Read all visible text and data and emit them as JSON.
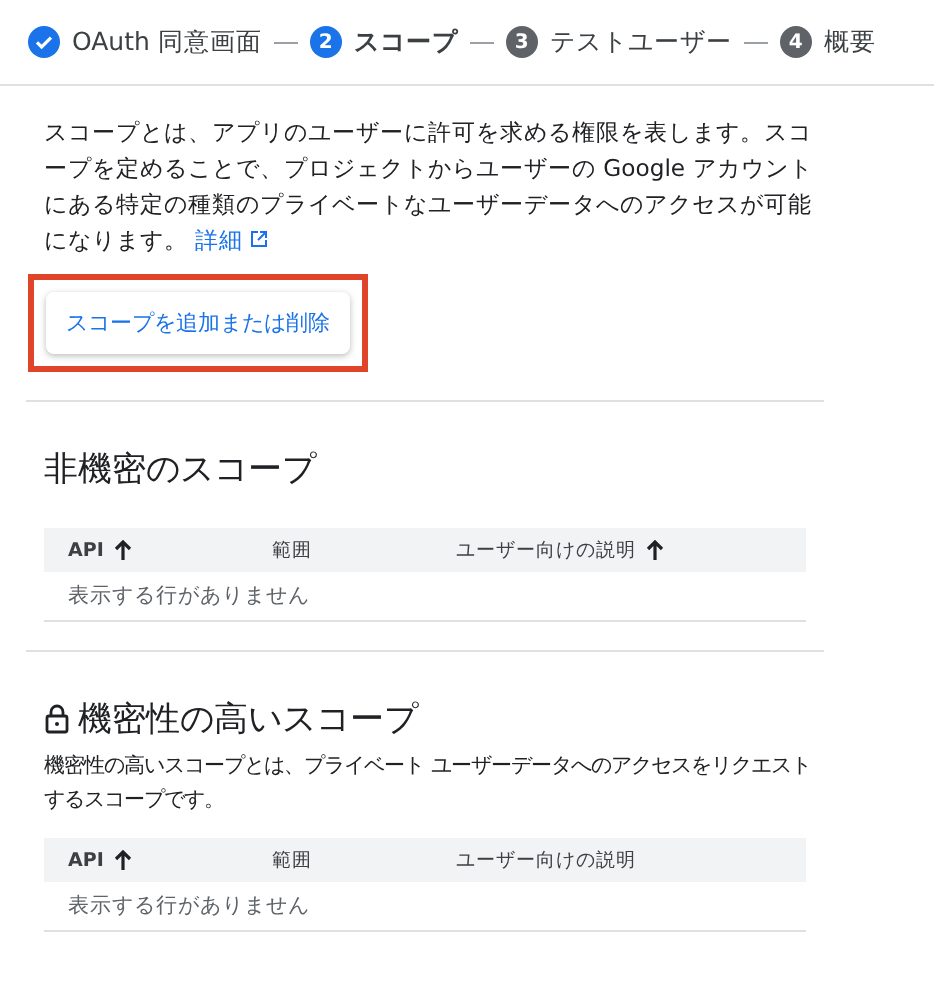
{
  "stepper": [
    {
      "kind": "done",
      "label": "OAuth 同意画面"
    },
    {
      "kind": "current",
      "number": "2",
      "label": "スコープ"
    },
    {
      "kind": "todo",
      "number": "3",
      "label": "テストユーザー"
    },
    {
      "kind": "todo",
      "number": "4",
      "label": "概要"
    }
  ],
  "intro": {
    "text": "スコープとは、アプリのユーザーに許可を求める権限を表します。スコープを定めることで、プロジェクトからユーザーの Google アカウントにある特定の種類のプライベートなユーザーデータへのアクセスが可能になります。",
    "link": "詳細"
  },
  "add_button": {
    "label": "スコープを追加または削除",
    "highlighted": true
  },
  "sections": [
    {
      "title": "非機密のスコープ",
      "locked": false,
      "columns": [
        {
          "label": "API",
          "sorted": true
        },
        {
          "label": "範囲",
          "sorted": false
        },
        {
          "label": "ユーザー向けの説明",
          "sorted": true
        }
      ],
      "empty": "表示する行がありません"
    },
    {
      "title": "機密性の高いスコープ",
      "locked": true,
      "description": "機密性の高いスコープとは、プライベート ユーザーデータへのアクセスをリクエストするスコープです。",
      "columns": [
        {
          "label": "API",
          "sorted": true
        },
        {
          "label": "範囲",
          "sorted": false
        },
        {
          "label": "ユーザー向けの説明",
          "sorted": false
        }
      ],
      "empty": "表示する行がありません"
    }
  ]
}
